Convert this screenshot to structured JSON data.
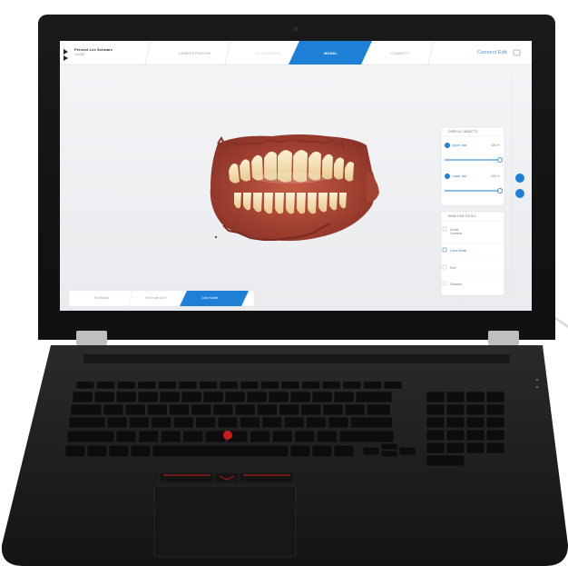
{
  "app": {
    "patient_name": "Prévost Lee Schwarz",
    "patient_id": "111000",
    "steps": [
      "ADMINISTRATION",
      "ACQUISITION",
      "MODEL",
      "CONNECT"
    ],
    "active_step": "MODEL",
    "brand": "Connect Edit"
  },
  "display_panel": {
    "title": "DISPLAY OBJECTS",
    "rows": [
      {
        "label": "Upper Jaw",
        "value": "100 %",
        "level": 1.0
      },
      {
        "label": "Lower Jaw",
        "value": "100 %",
        "level": 1.0
      }
    ]
  },
  "tools_panel": {
    "title": "ANALYSIS TOOLS",
    "items": [
      {
        "label": "Model Contacts"
      },
      {
        "label": "Color Model"
      },
      {
        "label": "Size"
      },
      {
        "label": "Distance"
      }
    ],
    "active_item": "Color Model"
  },
  "bottom_tabs": {
    "items": [
      "Edit Model",
      "Set Model Arch",
      "Color Model"
    ],
    "active": "Color Model"
  },
  "colors": {
    "accent": "#1e7fd6",
    "laptop_body": "#1b1b1b",
    "trackpoint": "#cc1b1b",
    "gums": "#b04a3a",
    "teeth": "#f1d9a6"
  }
}
